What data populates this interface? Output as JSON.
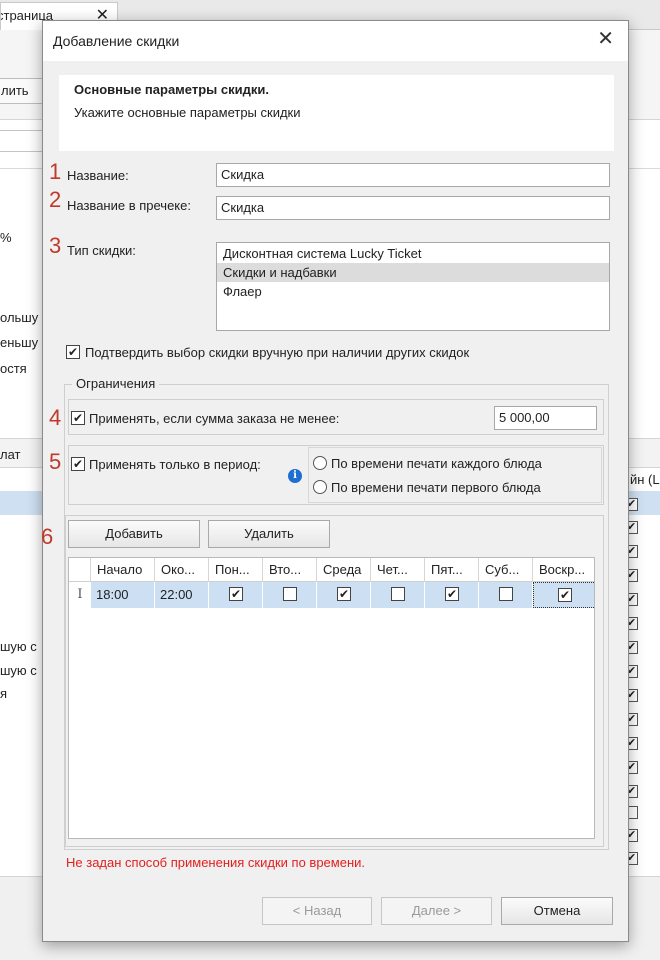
{
  "background": {
    "tab_label": "страница",
    "tab_close": "✕",
    "toolbar_button_label": "лить",
    "left_texts": [
      "%",
      "ольшу",
      "еньшу",
      "остя",
      "лат",
      "шую с",
      "шую с",
      "я"
    ],
    "right_header": "йн (L"
  },
  "dialog": {
    "title": "Добавление скидки",
    "close_glyph": "✕",
    "header": {
      "title": "Основные параметры скидки.",
      "subtitle": "Укажите основные параметры скидки"
    },
    "markers": [
      "1",
      "2",
      "3",
      "4",
      "5",
      "6"
    ],
    "name": {
      "label": "Название:",
      "value": "Скидка"
    },
    "receipt_name": {
      "label": "Название в пречеке:",
      "value": "Скидка"
    },
    "discount_type": {
      "label": "Тип скидки:",
      "items": [
        "Дисконтная система Lucky Ticket",
        "Скидки и надбавки",
        "Флаер"
      ],
      "selected_index": 1
    },
    "confirm_manually": {
      "label": "Подтвердить выбор скидки вручную при наличии других скидок",
      "checked": true
    },
    "restrictions": {
      "title": "Ограничения",
      "min_sum": {
        "label": "Применять, если сумма заказа не менее:",
        "checked": true,
        "value": "5 000,00"
      },
      "period": {
        "label": "Применять только в период:",
        "checked": true,
        "options": [
          "По времени печати каждого блюда",
          "По времени печати первого блюда"
        ],
        "selected_index": -1
      },
      "add_button": "Добавить",
      "delete_button": "Удалить",
      "grid": {
        "columns": [
          "Начало",
          "Око...",
          "Пон...",
          "Вто...",
          "Среда",
          "Чет...",
          "Пят...",
          "Суб...",
          "Воскр..."
        ],
        "rows": [
          {
            "start": "18:00",
            "end": "22:00",
            "days": [
              true,
              false,
              true,
              false,
              true,
              false,
              true
            ]
          }
        ]
      }
    },
    "error": "Не задан способ применения скидки по времени.",
    "buttons": {
      "back": "< Назад",
      "next": "Далее >",
      "cancel": "Отмена"
    },
    "colors": {
      "marker": "#c0392b",
      "error": "#e32020",
      "selection": "#cde0f3",
      "info_icon": "#1e6fd0"
    }
  }
}
